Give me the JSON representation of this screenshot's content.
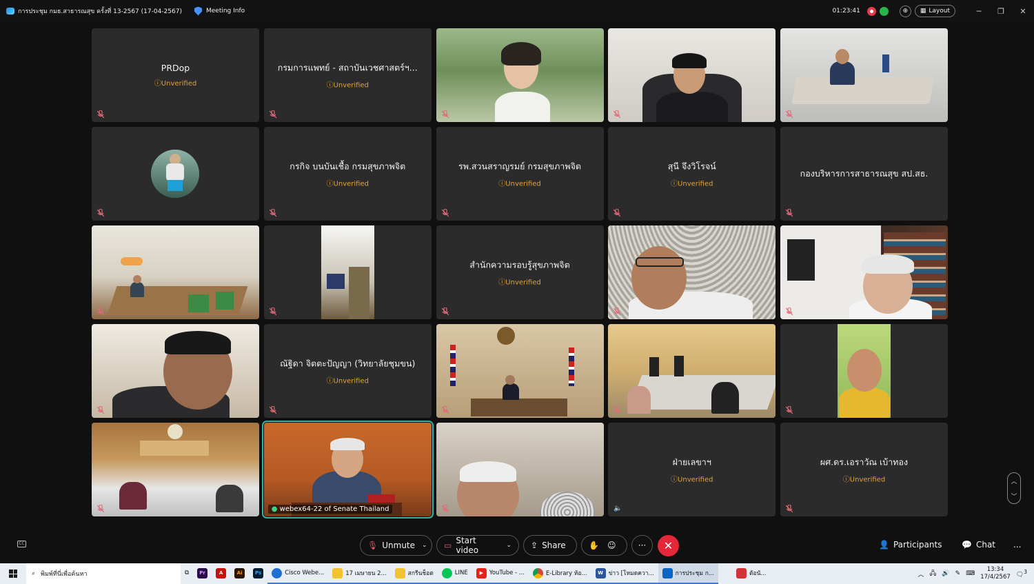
{
  "titlebar": {
    "meeting_title": "การประชุม กมธ.สาธารณสุข ครั้งที่ 13-2567 (17-04-2567)",
    "meeting_info": "Meeting Info",
    "timer": "01:23:41",
    "layout_label": "Layout"
  },
  "tiles": [
    {
      "name": "PRDop",
      "status": "Unverified"
    },
    {
      "name": "กรมการแพทย์ - สถาบันเวชศาสตร์ฯ...",
      "status": "Unverified"
    },
    {
      "name": "",
      "status": ""
    },
    {
      "name": "",
      "status": ""
    },
    {
      "name": "",
      "status": ""
    },
    {
      "name": "",
      "status": ""
    },
    {
      "name": "กรกิจ บนบันเชื้อ กรมสุขภาพจิต",
      "status": "Unverified"
    },
    {
      "name": "รพ.สวนสราญรมย์ กรมสุขภาพจิต",
      "status": "Unverified"
    },
    {
      "name": "สุนี จึงวิโรจน์",
      "status": "Unverified"
    },
    {
      "name": "กองบริหารการสาธารณสุข สป.สธ.",
      "status": ""
    },
    {
      "name": "",
      "status": ""
    },
    {
      "name": "",
      "status": ""
    },
    {
      "name": "สำนักความรอบรู้สุขภาพจิต",
      "status": "Unverified"
    },
    {
      "name": "",
      "status": ""
    },
    {
      "name": "",
      "status": ""
    },
    {
      "name": "",
      "status": ""
    },
    {
      "name": "ณัฐิดา จิตตะปัญญา (วิทยาลัยชุมขน)",
      "status": "Unverified"
    },
    {
      "name": "",
      "status": ""
    },
    {
      "name": "",
      "status": ""
    },
    {
      "name": "",
      "status": ""
    },
    {
      "name": "",
      "status": ""
    },
    {
      "name": "webex64-22 of Senate Thailand",
      "status": ""
    },
    {
      "name": "",
      "status": ""
    },
    {
      "name": "ฝ่ายเลขาฯ",
      "status": "Unverified"
    },
    {
      "name": "ผศ.ดร.เอราวัณ เบ้าทอง",
      "status": "Unverified"
    }
  ],
  "controls": {
    "unmute": "Unmute",
    "start_video": "Start video",
    "share": "Share",
    "participants": "Participants",
    "chat": "Chat",
    "more": "..."
  },
  "taskbar": {
    "search_placeholder": "พิมพ์ที่นี่เพื่อค้นหา",
    "apps": [
      {
        "label": "Cisco Webe...",
        "color": "#1f6fd1"
      },
      {
        "label": "17 เมษายน 2...",
        "color": "#f1c232"
      },
      {
        "label": "สกรีนช็อต",
        "color": "#f1c232"
      },
      {
        "label": "LINE",
        "color": "#06c755"
      },
      {
        "label": "YouTube - ...",
        "color": "#e62117"
      },
      {
        "label": "E-Library ห้อ...",
        "color": "#db4437"
      },
      {
        "label": "ข่าว [โหมดควา...",
        "color": "#2b579a"
      },
      {
        "label": "การประชุม ก...",
        "color": "#0b66c3"
      },
      {
        "label": "ต้อนั...",
        "color": "#d13438"
      }
    ],
    "time": "13:34",
    "date": "17/4/2567",
    "notification_count": "3"
  }
}
